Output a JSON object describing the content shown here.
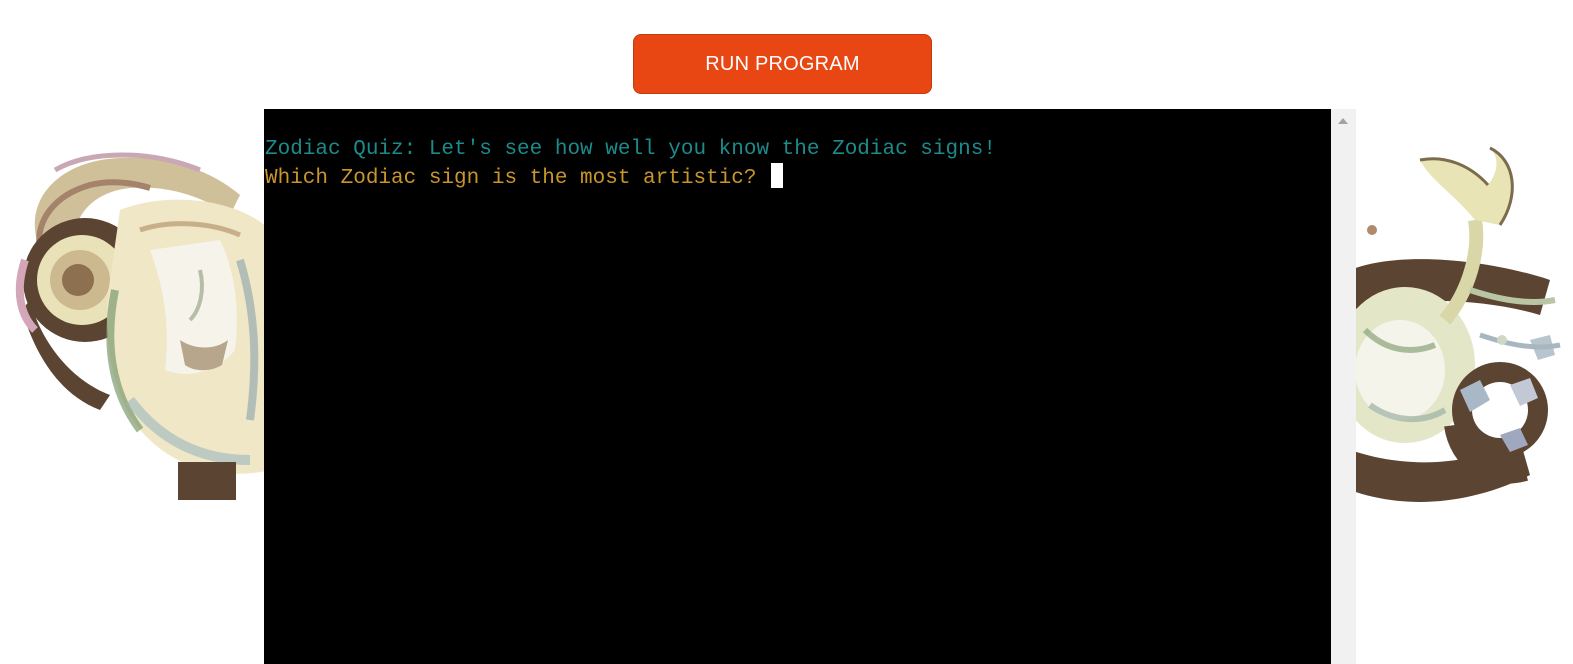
{
  "run_button": {
    "label": "RUN PROGRAM",
    "color": "#e84612"
  },
  "terminal": {
    "lines": [
      {
        "text": "Zodiac Quiz: Let's see how well you know the Zodiac signs!",
        "color": "#1b8b8b"
      },
      {
        "text": "Which Zodiac sign is the most artistic? ",
        "color": "#c8962a"
      }
    ],
    "background": "#000000"
  },
  "decorations": {
    "left_image": "aries-ram-illustration",
    "right_image": "cancer-crab-illustration"
  },
  "scrollbar": {
    "up_icon": "scroll-up-arrow-icon"
  }
}
